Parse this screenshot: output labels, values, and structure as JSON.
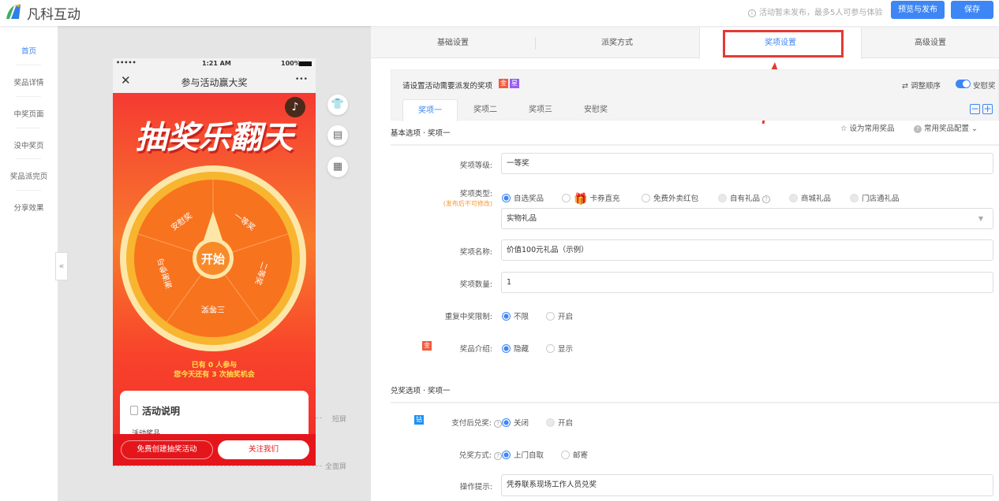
{
  "header": {
    "brand": "凡科互动",
    "notice": "活动暂未发布，最多5人可参与体验",
    "preview_publish": "预览与发布",
    "save": "保存"
  },
  "sidebar": {
    "items": [
      "首页",
      "奖品详情",
      "中奖页面",
      "没中奖页",
      "奖品派完页",
      "分享效果"
    ],
    "active": 0
  },
  "phone": {
    "signal": "•••••",
    "time": "1:21 AM",
    "battery": "100%",
    "title": "参与活动赢大奖",
    "close": "✕",
    "more": "•••",
    "banner": "抽奖乐翻天",
    "wheel": {
      "start": "开始",
      "segments": [
        "安慰奖",
        "一等奖",
        "二等奖",
        "三等奖",
        "谢谢参与"
      ]
    },
    "participants": "已有 0 人参与",
    "chances": "您今天还有 3 次抽奖机会",
    "desc_title": "活动说明",
    "desc_item": "活动奖品",
    "btn_create": "免费创建抽奖活动",
    "btn_follow": "关注我们"
  },
  "guides": {
    "short": "短屏",
    "full": "全面屏"
  },
  "collapse": "«",
  "tabs": [
    "基础设置",
    "派奖方式",
    "奖项设置",
    "高级设置"
  ],
  "active_tab": 2,
  "prize": {
    "prompt": "请设置活动需要派发的奖项",
    "badge_gold": "金",
    "badge_star": "星",
    "reorder": "调整顺序",
    "consolation_toggle": "安慰奖",
    "consolation_on": true,
    "tabs": [
      "奖项一",
      "奖项二",
      "奖项三",
      "安慰奖"
    ],
    "active": 0
  },
  "basic": {
    "title": "基本选项 · 奖项一",
    "set_common": "设为常用奖品",
    "common_config": "常用奖品配置",
    "level_label": "奖项等级:",
    "level_value": "一等奖",
    "type_label": "奖项类型:",
    "type_note": "(发布后不可修改)",
    "types": [
      "自选奖品",
      "卡券直充",
      "免费外卖红包",
      "自有礼品",
      "商城礼品",
      "门店通礼品"
    ],
    "subtype": "实物礼品",
    "name_label": "奖项名称:",
    "name_value": "价值100元礼品（示例）",
    "qty_label": "奖项数量:",
    "qty_value": "1",
    "repeat_label": "重复中奖限制:",
    "repeat_opts": [
      "不限",
      "开启"
    ],
    "intro_label": "奖品介绍:",
    "intro_opts": [
      "隐藏",
      "显示"
    ]
  },
  "redeem": {
    "title": "兑奖选项 · 奖项一",
    "pay_label": "支付后兑奖:",
    "pay_badge": "钻",
    "pay_opts": [
      "关闭",
      "开启"
    ],
    "method_label": "兑奖方式:",
    "method_opts": [
      "上门自取",
      "邮寄"
    ],
    "tip_label": "操作提示:",
    "tip_value": "凭券联系现场工作人员兑奖"
  },
  "colors": {
    "accent": "#3d86f5",
    "highlight": "#e53935"
  }
}
